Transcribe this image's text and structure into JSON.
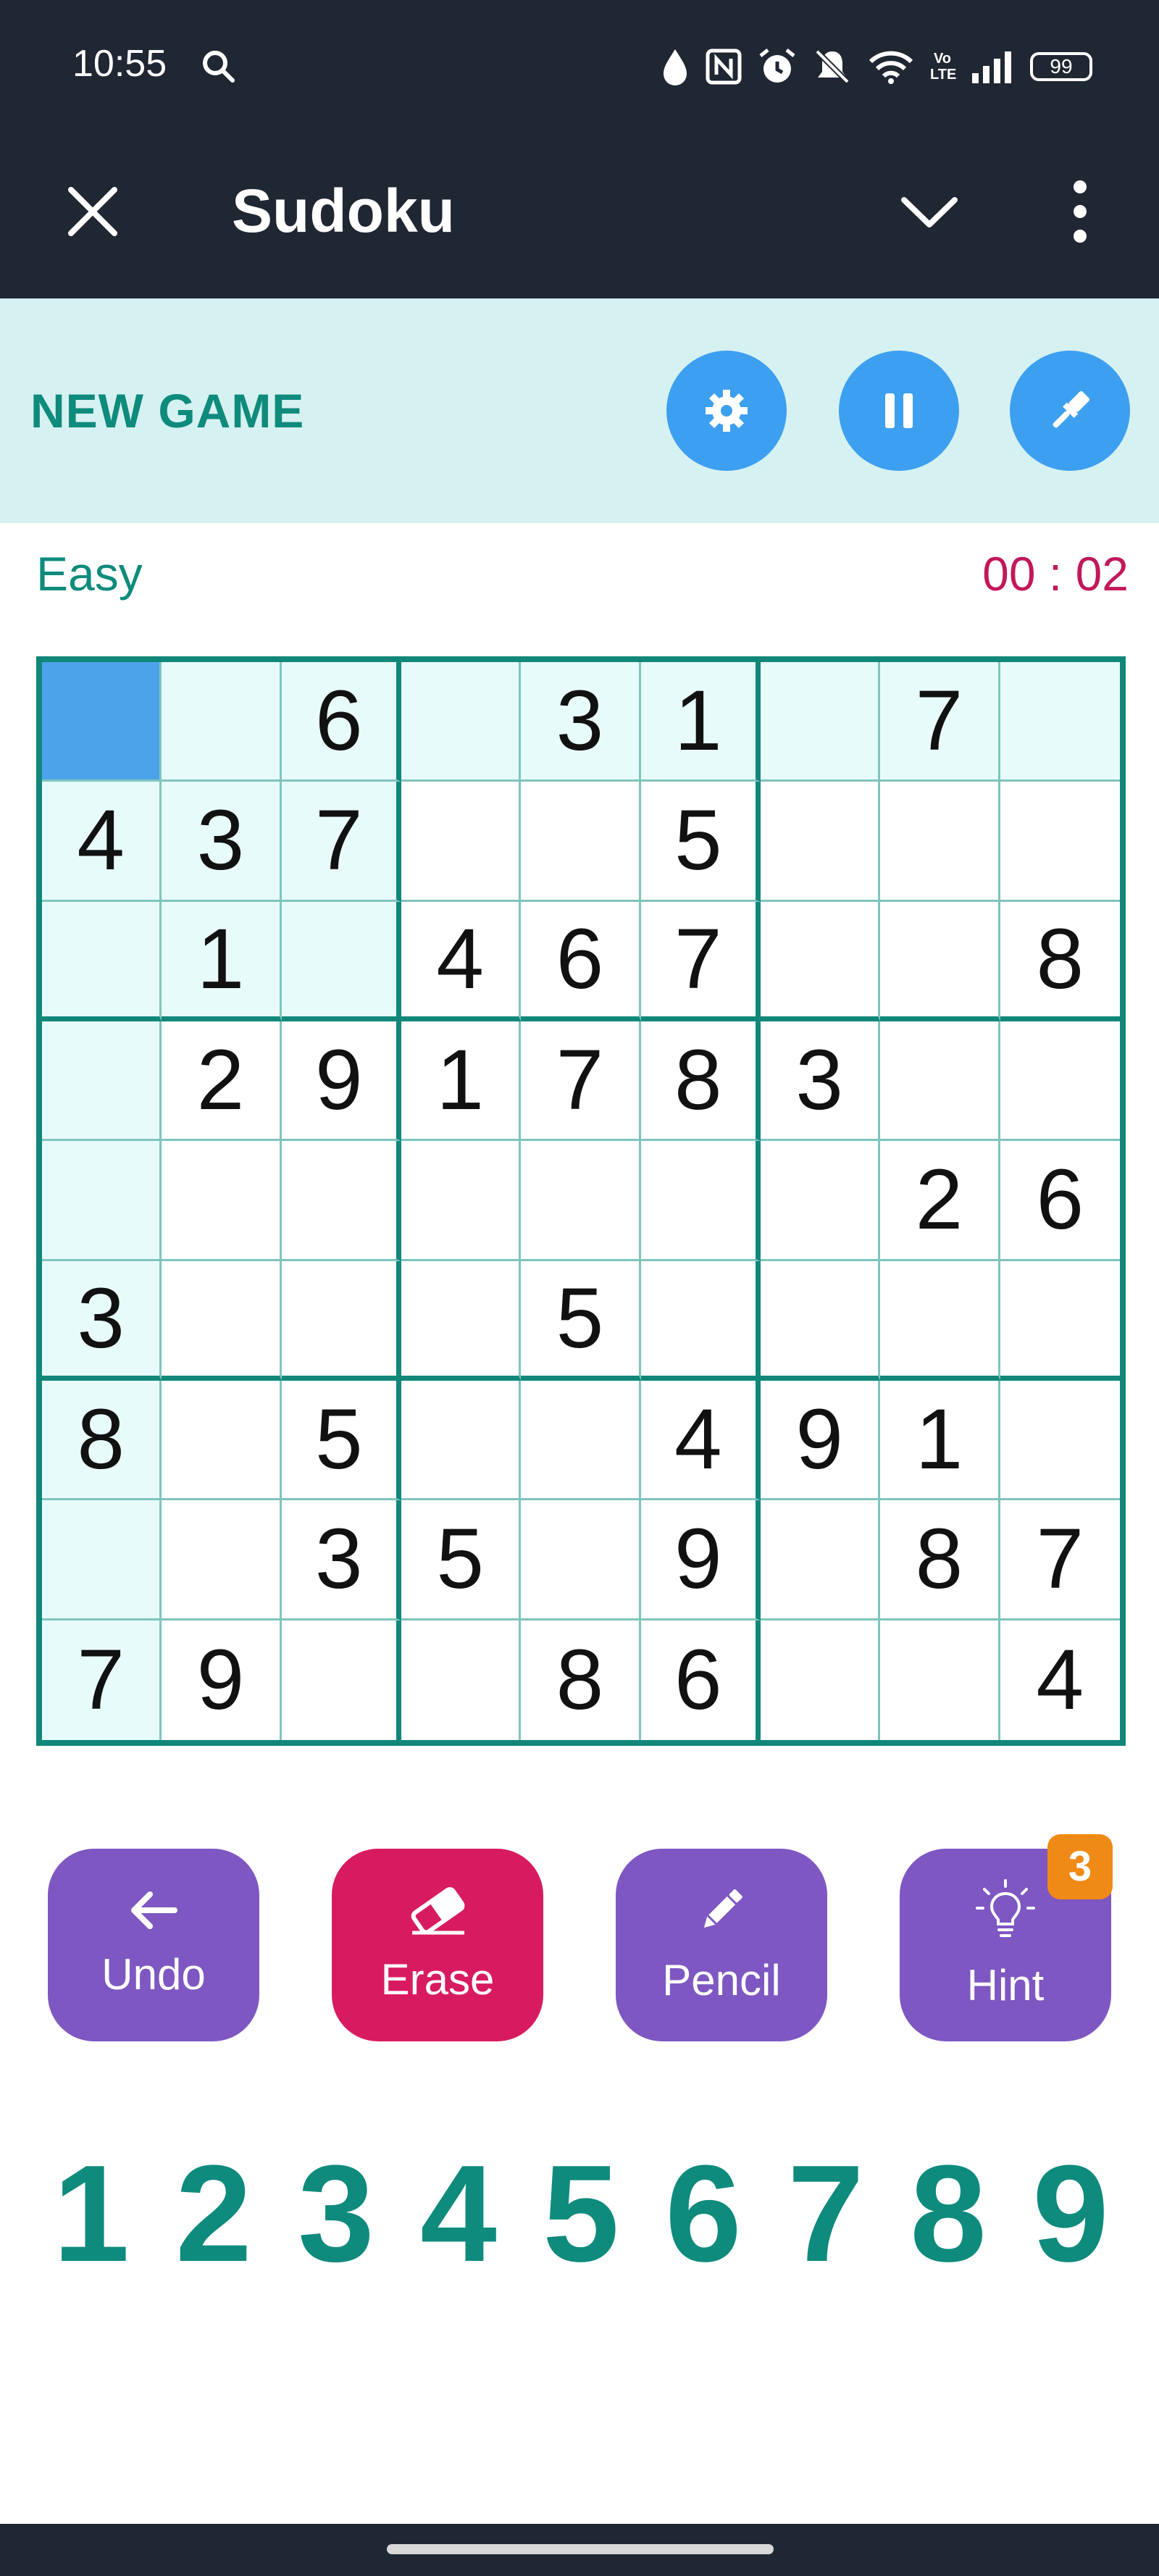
{
  "status_bar": {
    "time": "10:55",
    "battery": "99",
    "network_label": "Vo LTE"
  },
  "app_bar": {
    "title": "Sudoku"
  },
  "toolbar": {
    "new_game_label": "NEW GAME"
  },
  "game": {
    "level": "Easy",
    "timer": "00 : 02",
    "selected_cell": [
      0,
      0
    ],
    "grid": [
      [
        "",
        "",
        "6",
        "",
        "3",
        "1",
        "",
        "7",
        ""
      ],
      [
        "4",
        "3",
        "7",
        "",
        "",
        "5",
        "",
        "",
        ""
      ],
      [
        "",
        "1",
        "",
        "4",
        "6",
        "7",
        "",
        "",
        "8"
      ],
      [
        "",
        "2",
        "9",
        "1",
        "7",
        "8",
        "3",
        "",
        ""
      ],
      [
        "",
        "",
        "",
        "",
        "",
        "",
        "",
        "2",
        "6"
      ],
      [
        "3",
        "",
        "",
        "",
        "5",
        "",
        "",
        "",
        ""
      ],
      [
        "8",
        "",
        "5",
        "",
        "",
        "4",
        "9",
        "1",
        ""
      ],
      [
        "",
        "",
        "3",
        "5",
        "",
        "9",
        "",
        "8",
        "7"
      ],
      [
        "7",
        "9",
        "",
        "",
        "8",
        "6",
        "",
        "",
        "4"
      ]
    ]
  },
  "actions": {
    "undo_label": "Undo",
    "erase_label": "Erase",
    "pencil_label": "Pencil",
    "hint_label": "Hint",
    "hint_count": "3"
  },
  "colors": {
    "accent_teal": "#0e8b7c",
    "round_button_blue": "#3d9ff0",
    "undo_purple": "#7e57c2",
    "erase_pink": "#d81b60",
    "timer_red": "#c2185b",
    "selected_cell": "#4da3ea"
  },
  "numpad": [
    "1",
    "2",
    "3",
    "4",
    "5",
    "6",
    "7",
    "8",
    "9"
  ]
}
